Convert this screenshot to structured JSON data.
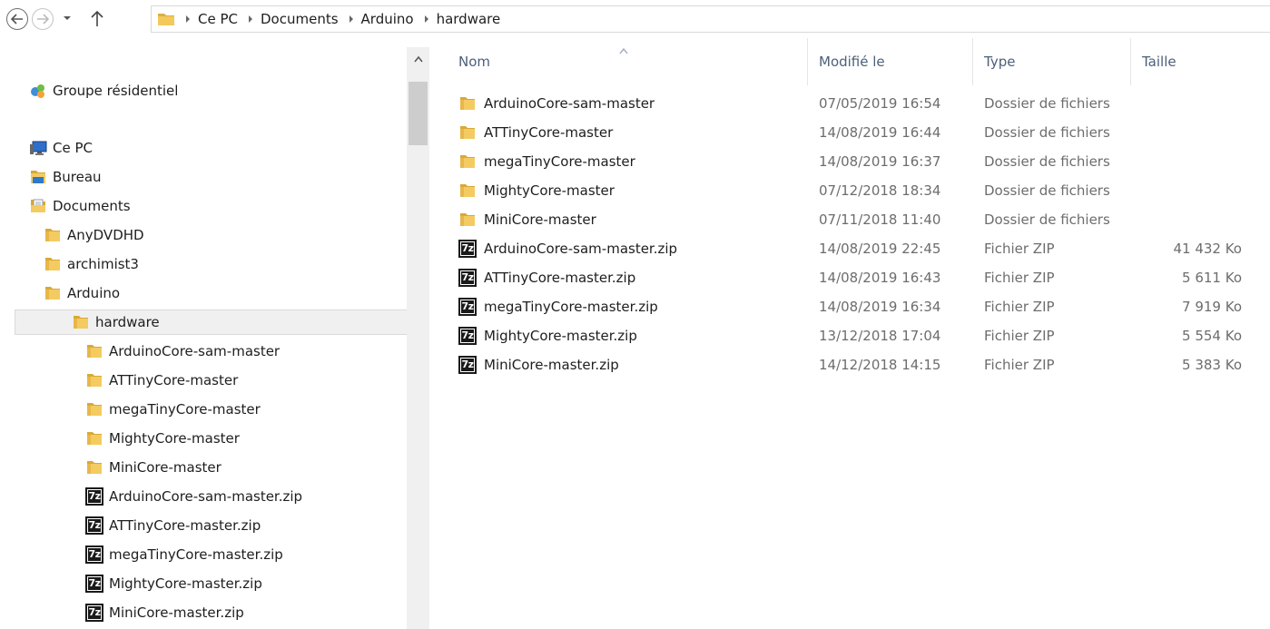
{
  "address_bar": {
    "crumbs": [
      "Ce PC",
      "Documents",
      "Arduino",
      "hardware"
    ]
  },
  "nav": {
    "items": [
      {
        "label": "Groupe résidentiel",
        "icon": "homegroup-icon",
        "indent": 0
      },
      {
        "label": "Ce PC",
        "icon": "computer-icon",
        "indent": 0
      },
      {
        "label": "Bureau",
        "icon": "desktop-folder-icon",
        "indent": 1
      },
      {
        "label": "Documents",
        "icon": "documents-folder-icon",
        "indent": 1
      },
      {
        "label": "AnyDVDHD",
        "icon": "folder-icon",
        "indent": 2
      },
      {
        "label": "archimist3",
        "icon": "folder-icon",
        "indent": 2
      },
      {
        "label": "Arduino",
        "icon": "folder-icon",
        "indent": 2
      },
      {
        "label": "hardware",
        "icon": "folder-icon",
        "indent": 3,
        "selected": true
      },
      {
        "label": "ArduinoCore-sam-master",
        "icon": "folder-icon",
        "indent": 4
      },
      {
        "label": "ATTinyCore-master",
        "icon": "folder-icon",
        "indent": 4
      },
      {
        "label": "megaTinyCore-master",
        "icon": "folder-icon",
        "indent": 4
      },
      {
        "label": "MightyCore-master",
        "icon": "folder-icon",
        "indent": 4
      },
      {
        "label": "MiniCore-master",
        "icon": "folder-icon",
        "indent": 4
      },
      {
        "label": "ArduinoCore-sam-master.zip",
        "icon": "7z-archive-icon",
        "indent": 4
      },
      {
        "label": "ATTinyCore-master.zip",
        "icon": "7z-archive-icon",
        "indent": 4
      },
      {
        "label": "megaTinyCore-master.zip",
        "icon": "7z-archive-icon",
        "indent": 4
      },
      {
        "label": "MightyCore-master.zip",
        "icon": "7z-archive-icon",
        "indent": 4
      },
      {
        "label": "MiniCore-master.zip",
        "icon": "7z-archive-icon",
        "indent": 4
      }
    ]
  },
  "columns": {
    "name": "Nom",
    "modified": "Modifié le",
    "type": "Type",
    "size": "Taille"
  },
  "files": [
    {
      "name": "ArduinoCore-sam-master",
      "modified": "07/05/2019 16:54",
      "type": "Dossier de fichiers",
      "size": "",
      "icon": "folder-icon"
    },
    {
      "name": "ATTinyCore-master",
      "modified": "14/08/2019 16:44",
      "type": "Dossier de fichiers",
      "size": "",
      "icon": "folder-icon"
    },
    {
      "name": "megaTinyCore-master",
      "modified": "14/08/2019 16:37",
      "type": "Dossier de fichiers",
      "size": "",
      "icon": "folder-icon"
    },
    {
      "name": "MightyCore-master",
      "modified": "07/12/2018 18:34",
      "type": "Dossier de fichiers",
      "size": "",
      "icon": "folder-icon"
    },
    {
      "name": "MiniCore-master",
      "modified": "07/11/2018 11:40",
      "type": "Dossier de fichiers",
      "size": "",
      "icon": "folder-icon"
    },
    {
      "name": "ArduinoCore-sam-master.zip",
      "modified": "14/08/2019 22:45",
      "type": "Fichier ZIP",
      "size": "41 432 Ko",
      "icon": "7z-archive-icon"
    },
    {
      "name": "ATTinyCore-master.zip",
      "modified": "14/08/2019 16:43",
      "type": "Fichier ZIP",
      "size": "5 611 Ko",
      "icon": "7z-archive-icon"
    },
    {
      "name": "megaTinyCore-master.zip",
      "modified": "14/08/2019 16:34",
      "type": "Fichier ZIP",
      "size": "7 919 Ko",
      "icon": "7z-archive-icon"
    },
    {
      "name": "MightyCore-master.zip",
      "modified": "13/12/2018 17:04",
      "type": "Fichier ZIP",
      "size": "5 554 Ko",
      "icon": "7z-archive-icon"
    },
    {
      "name": "MiniCore-master.zip",
      "modified": "14/12/2018 14:15",
      "type": "Fichier ZIP",
      "size": "5 383 Ko",
      "icon": "7z-archive-icon"
    }
  ],
  "colors": {
    "folder": "#e8b74a",
    "header_text": "#4c607a",
    "selection": "#f0f0f0"
  }
}
